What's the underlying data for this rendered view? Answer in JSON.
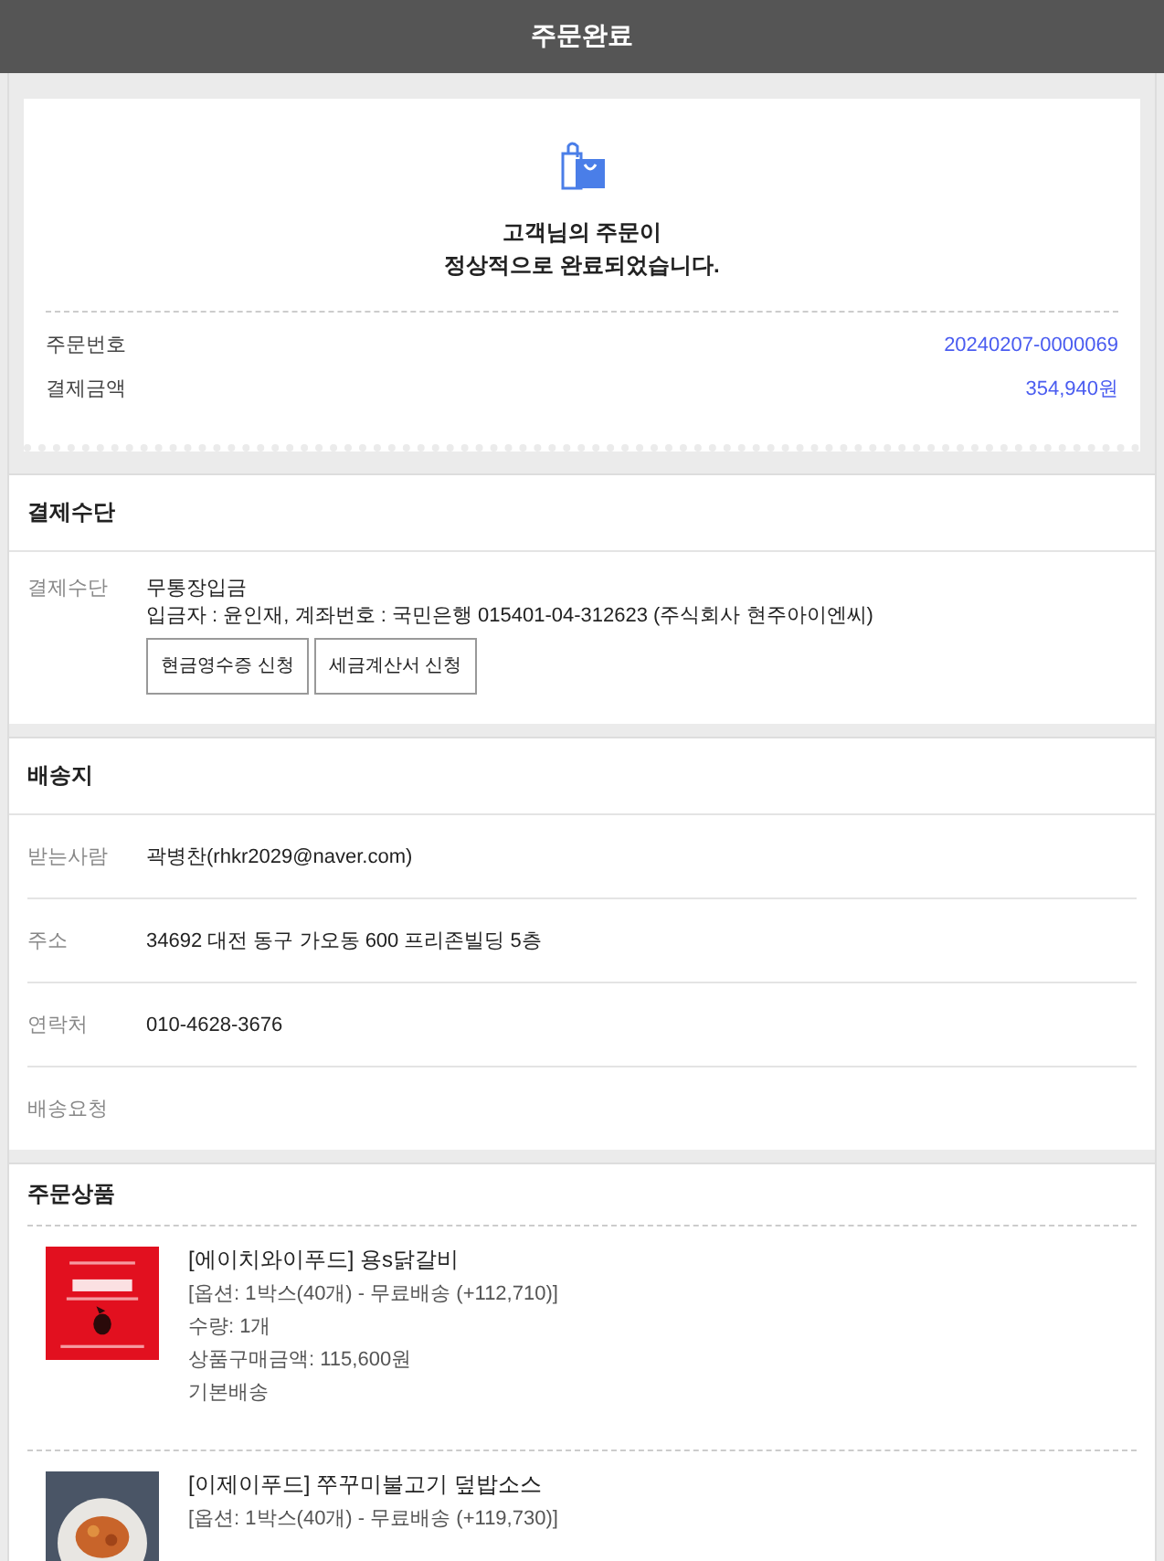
{
  "header": {
    "title": "주문완료"
  },
  "complete": {
    "message_lines": [
      "고객님의 주문이",
      "정상적으로 완료되었습니다."
    ],
    "rows": [
      {
        "label": "주문번호",
        "value": "20240207-0000069"
      },
      {
        "label": "결제금액",
        "value": "354,940원"
      }
    ]
  },
  "payment": {
    "title": "결제수단",
    "label": "결제수단",
    "method": "무통장입금",
    "detail": "입금자 : 윤인재, 계좌번호 : 국민은행 015401-04-312623 (주식회사 현주아이엔씨)",
    "buttons": [
      "현금영수증 신청",
      "세금계산서 신청"
    ]
  },
  "shipping": {
    "title": "배송지",
    "rows": [
      {
        "label": "받는사람",
        "value": "곽병찬(rhkr2029@naver.com)"
      },
      {
        "label": "주소",
        "value": "34692 대전 동구 가오동 600 프리존빌딩 5층"
      },
      {
        "label": "연락처",
        "value": "010-4628-3676"
      },
      {
        "label": "배송요청"
      }
    ]
  },
  "products": {
    "title": "주문상품",
    "items": [
      {
        "image": {
          "kind": "picture"
        },
        "name": "[에이치와이푸드] 용s닭갈비",
        "lines": [
          "[옵션: 1박스(40개) - 무료배송 (+112,710)]",
          "수량: 1개",
          "상품구매금액: 115,600원",
          "기본배송"
        ]
      },
      {
        "image": {
          "kind": "picture"
        },
        "name": "[이제이푸드] 쭈꾸미불고기 덮밥소스",
        "lines": [
          "[옵션: 1박스(40개) - 무료배송 (+119,730)]"
        ]
      }
    ]
  }
}
